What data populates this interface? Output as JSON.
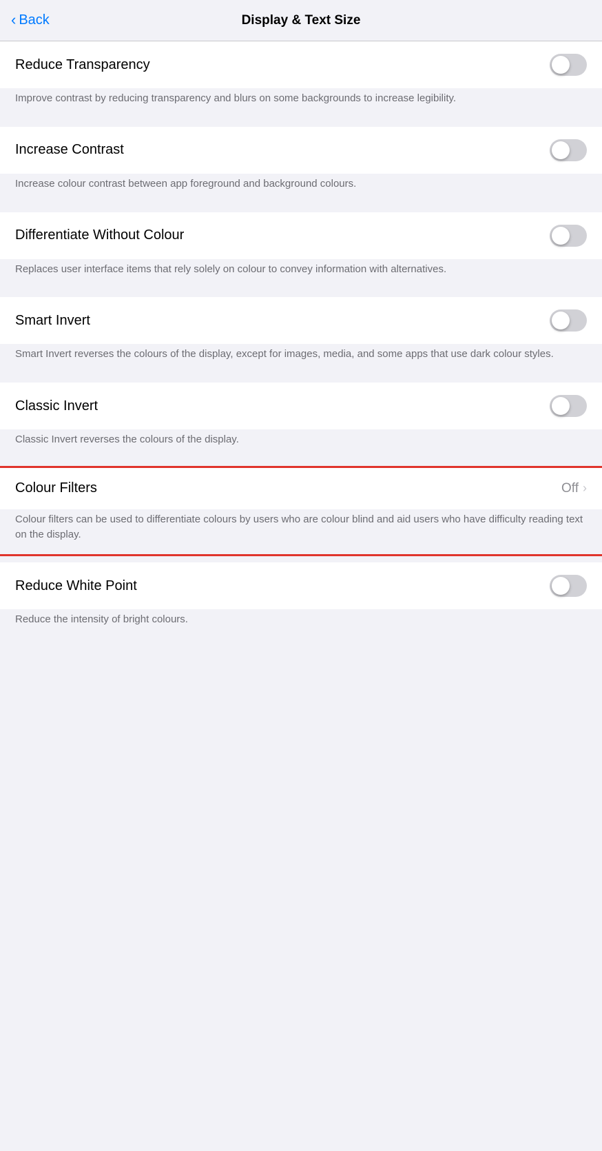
{
  "header": {
    "back_label": "Back",
    "title": "Display & Text Size"
  },
  "settings": [
    {
      "id": "reduce-transparency",
      "label": "Reduce Transparency",
      "type": "toggle",
      "enabled": false,
      "description": "Improve contrast by reducing transparency and blurs on some backgrounds to increase legibility."
    },
    {
      "id": "increase-contrast",
      "label": "Increase Contrast",
      "type": "toggle",
      "enabled": false,
      "description": "Increase colour contrast between app foreground and background colours."
    },
    {
      "id": "differentiate-without-colour",
      "label": "Differentiate Without Colour",
      "type": "toggle",
      "enabled": false,
      "description": "Replaces user interface items that rely solely on colour to convey information with alternatives."
    },
    {
      "id": "smart-invert",
      "label": "Smart Invert",
      "type": "toggle",
      "enabled": false,
      "description": "Smart Invert reverses the colours of the display, except for images, media, and some apps that use dark colour styles."
    },
    {
      "id": "classic-invert",
      "label": "Classic Invert",
      "type": "toggle",
      "enabled": false,
      "description": "Classic Invert reverses the colours of the display."
    },
    {
      "id": "colour-filters",
      "label": "Colour Filters",
      "type": "nav",
      "value": "Off",
      "highlighted": true,
      "description": "Colour filters can be used to differentiate colours by users who are colour blind and aid users who have difficulty reading text on the display."
    },
    {
      "id": "reduce-white-point",
      "label": "Reduce White Point",
      "type": "toggle",
      "enabled": false,
      "description": "Reduce the intensity of bright colours."
    }
  ]
}
